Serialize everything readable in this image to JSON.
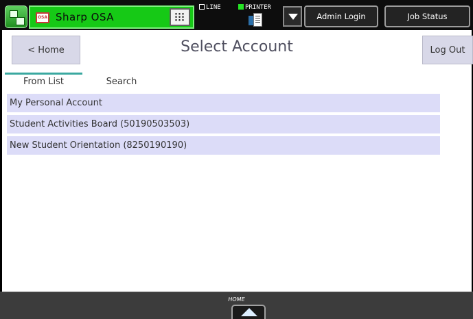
{
  "topbar": {
    "app_title": "Sharp OSA",
    "osa_badge": "OSA",
    "line_label": "LINE",
    "printer_label": "PRINTER",
    "admin_login": "Admin Login",
    "job_status": "Job Status"
  },
  "main": {
    "home_button": "< Home",
    "title": "Select Account",
    "logout_button": "Log Out",
    "tabs": [
      {
        "label": "From List",
        "active": true
      },
      {
        "label": "Search",
        "active": false
      }
    ],
    "accounts": [
      {
        "label": "My Personal Account"
      },
      {
        "label": "Student Activities Board (50190503503)"
      },
      {
        "label": "New Student Orientation (8250190190)"
      }
    ]
  },
  "bottombar": {
    "home_label": "HOME"
  },
  "colors": {
    "app_bar_green": "#16c916",
    "tab_accent": "#3aa8a0",
    "row_bg": "#dcdcf8",
    "button_bg": "#d8d8e8"
  },
  "icons": [
    "app-launcher-icon",
    "osa-logo-icon",
    "keypad-icon",
    "printer-icon",
    "chevron-down-icon",
    "home-arrow-icon"
  ]
}
